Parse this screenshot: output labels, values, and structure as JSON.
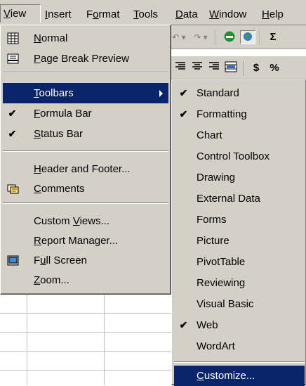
{
  "menubar": {
    "items": [
      {
        "label": "View",
        "u": "V"
      },
      {
        "label": "Insert",
        "u": "I"
      },
      {
        "label": "Format",
        "u": "o"
      },
      {
        "label": "Tools",
        "u": "T"
      },
      {
        "label": "Data",
        "u": "D"
      },
      {
        "label": "Window",
        "u": "W"
      },
      {
        "label": "Help",
        "u": "H"
      }
    ]
  },
  "view_menu": {
    "items": [
      {
        "label": "Normal",
        "icon": "normal-view-icon"
      },
      {
        "label": "Page Break Preview",
        "icon": "page-break-preview-icon"
      },
      {
        "label": "Toolbars",
        "submenu": true,
        "highlighted": true
      },
      {
        "label": "Formula Bar",
        "checked": true
      },
      {
        "label": "Status Bar",
        "checked": true
      },
      {
        "label": "Header and Footer..."
      },
      {
        "label": "Comments",
        "icon": "comments-icon"
      },
      {
        "label": "Custom Views..."
      },
      {
        "label": "Report Manager..."
      },
      {
        "label": "Full Screen",
        "icon": "full-screen-icon"
      },
      {
        "label": "Zoom..."
      }
    ]
  },
  "toolbars_submenu": {
    "items": [
      {
        "label": "Standard",
        "checked": true
      },
      {
        "label": "Formatting",
        "checked": true
      },
      {
        "label": "Chart"
      },
      {
        "label": "Control Toolbox"
      },
      {
        "label": "Drawing"
      },
      {
        "label": "External Data"
      },
      {
        "label": "Forms"
      },
      {
        "label": "Picture"
      },
      {
        "label": "PivotTable"
      },
      {
        "label": "Reviewing"
      },
      {
        "label": "Visual Basic"
      },
      {
        "label": "Web",
        "checked": true
      },
      {
        "label": "WordArt"
      },
      {
        "label": "Customize...",
        "highlighted": true
      }
    ]
  },
  "background_toolbar": {
    "currency_symbol": "$",
    "percent_symbol": "%",
    "autosum_symbol": "Σ"
  },
  "colors": {
    "menu_face": "#d4d0c8",
    "highlight": "#0a246a",
    "highlight_text": "#ffffff"
  }
}
